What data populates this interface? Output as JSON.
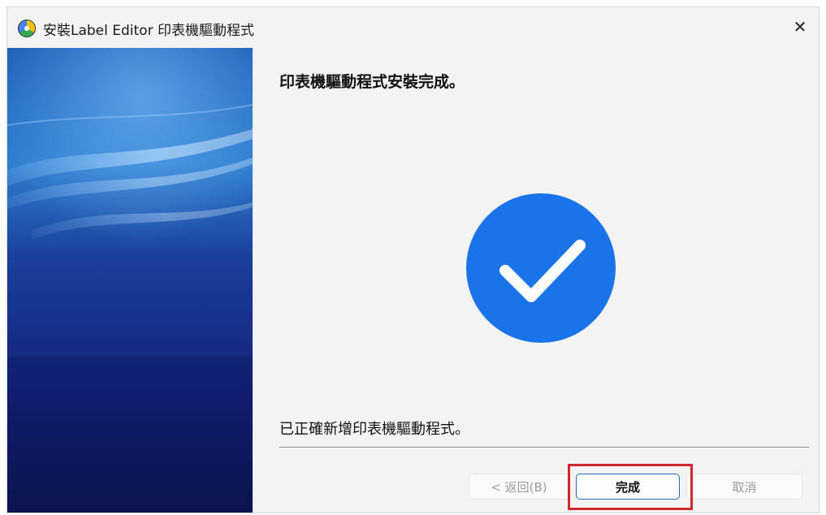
{
  "window": {
    "title": "安裝Label Editor 印表機驅動程式",
    "icon": "setup-shield-icon",
    "close_icon": "close-icon",
    "close_symbol": "✕"
  },
  "content": {
    "heading": "印表機驅動程式安裝完成。",
    "success_icon": "checkmark-circle-icon",
    "status": "已正確新增印表機驅動程式。"
  },
  "buttons": {
    "back": "< 返回(B)",
    "finish": "完成",
    "cancel": "取消"
  },
  "colors": {
    "accent": "#1a73e8",
    "highlight": "#d0282e",
    "side_panel_dark": "#0b1a5e",
    "side_panel_light": "#5fa6e8"
  }
}
